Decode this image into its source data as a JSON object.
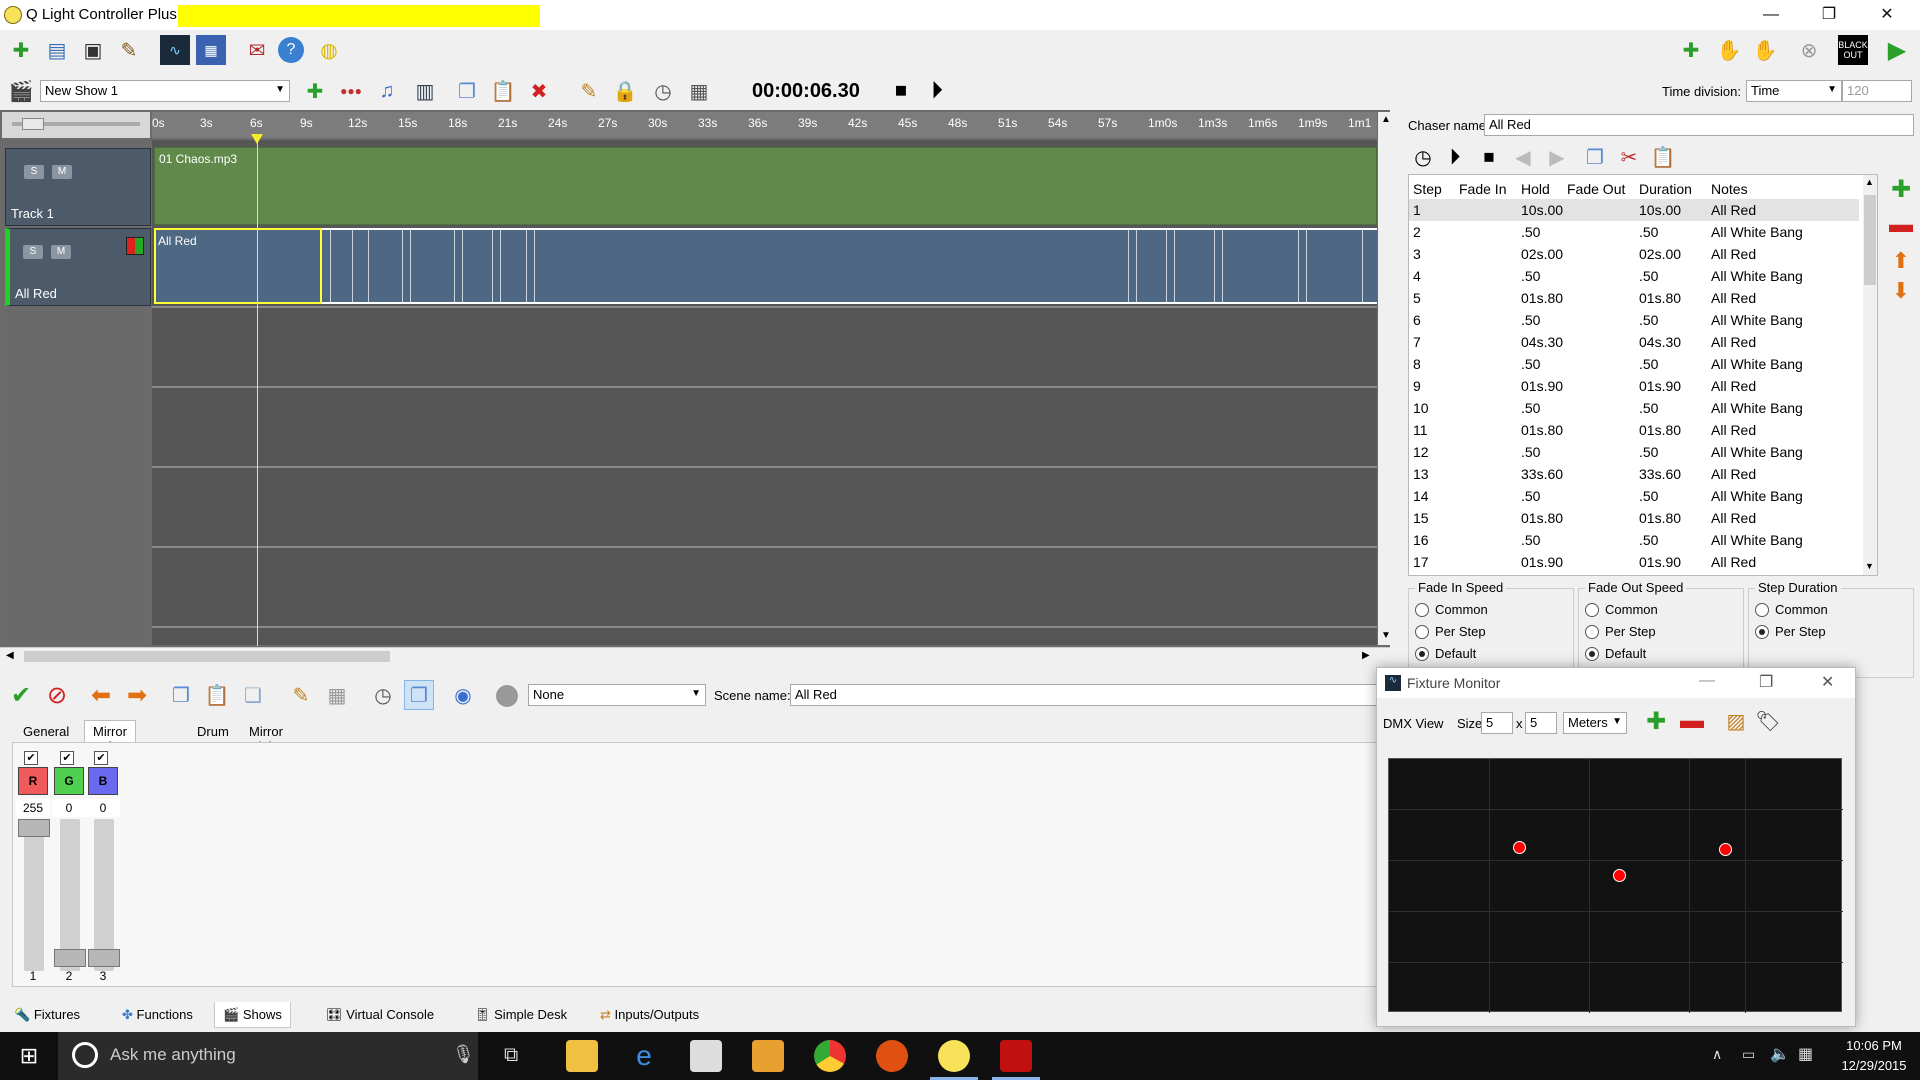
{
  "window": {
    "title": "Q Light Controller Plus",
    "controls": [
      "—",
      "❐",
      "✕"
    ]
  },
  "toolbar": {
    "items": [
      "new-workspace",
      "open-workspace",
      "save-workspace",
      "save-as",
      "monitor",
      "dmx-dump",
      "address-tool",
      "help",
      "about"
    ],
    "right_items": [
      "blackout-toggle-label",
      "run-mode"
    ],
    "blackout_label_line1": "BLACK",
    "blackout_label_line2": "OUT"
  },
  "show_toolbar": {
    "show_name": "New Show 1",
    "time": "00:00:06.30",
    "time_division_label": "Time division:",
    "time_division_value": "Time",
    "bpm_value": "120"
  },
  "timeline": {
    "ticks": [
      "0s",
      "3s",
      "6s",
      "9s",
      "12s",
      "15s",
      "18s",
      "21s",
      "24s",
      "27s",
      "30s",
      "33s",
      "36s",
      "39s",
      "42s",
      "45s",
      "48s",
      "51s",
      "54s",
      "57s",
      "1m0s",
      "1m3s",
      "1m6s",
      "1m9s",
      "1m1"
    ],
    "tracks": [
      {
        "name": "Track 1",
        "solo": "S",
        "mute": "M"
      },
      {
        "name": "All Red",
        "solo": "S",
        "mute": "M"
      }
    ],
    "audio_item_label": "01 Chaos.mp3",
    "chaser_item_label": "All Red"
  },
  "chaser_editor": {
    "name_label": "Chaser name",
    "name_value": "All Red",
    "columns": [
      "Step",
      "Fade In",
      "Hold",
      "Fade Out",
      "Duration",
      "Notes"
    ],
    "rows": [
      {
        "step": "1",
        "fade_in": "",
        "hold": "10s.00",
        "fade_out": "",
        "duration": "10s.00",
        "notes": "All Red"
      },
      {
        "step": "2",
        "fade_in": "",
        "hold": ".50",
        "fade_out": "",
        "duration": ".50",
        "notes": "All White Bang"
      },
      {
        "step": "3",
        "fade_in": "",
        "hold": "02s.00",
        "fade_out": "",
        "duration": "02s.00",
        "notes": "All Red"
      },
      {
        "step": "4",
        "fade_in": "",
        "hold": ".50",
        "fade_out": "",
        "duration": ".50",
        "notes": "All White Bang"
      },
      {
        "step": "5",
        "fade_in": "",
        "hold": "01s.80",
        "fade_out": "",
        "duration": "01s.80",
        "notes": "All Red"
      },
      {
        "step": "6",
        "fade_in": "",
        "hold": ".50",
        "fade_out": "",
        "duration": ".50",
        "notes": "All White Bang"
      },
      {
        "step": "7",
        "fade_in": "",
        "hold": "04s.30",
        "fade_out": "",
        "duration": "04s.30",
        "notes": "All Red"
      },
      {
        "step": "8",
        "fade_in": "",
        "hold": ".50",
        "fade_out": "",
        "duration": ".50",
        "notes": "All White Bang"
      },
      {
        "step": "9",
        "fade_in": "",
        "hold": "01s.90",
        "fade_out": "",
        "duration": "01s.90",
        "notes": "All Red"
      },
      {
        "step": "10",
        "fade_in": "",
        "hold": ".50",
        "fade_out": "",
        "duration": ".50",
        "notes": "All White Bang"
      },
      {
        "step": "11",
        "fade_in": "",
        "hold": "01s.80",
        "fade_out": "",
        "duration": "01s.80",
        "notes": "All Red"
      },
      {
        "step": "12",
        "fade_in": "",
        "hold": ".50",
        "fade_out": "",
        "duration": ".50",
        "notes": "All White Bang"
      },
      {
        "step": "13",
        "fade_in": "",
        "hold": "33s.60",
        "fade_out": "",
        "duration": "33s.60",
        "notes": "All Red"
      },
      {
        "step": "14",
        "fade_in": "",
        "hold": ".50",
        "fade_out": "",
        "duration": ".50",
        "notes": "All White Bang"
      },
      {
        "step": "15",
        "fade_in": "",
        "hold": "01s.80",
        "fade_out": "",
        "duration": "01s.80",
        "notes": "All Red"
      },
      {
        "step": "16",
        "fade_in": "",
        "hold": ".50",
        "fade_out": "",
        "duration": ".50",
        "notes": "All White Bang"
      },
      {
        "step": "17",
        "fade_in": "",
        "hold": "01s.90",
        "fade_out": "",
        "duration": "01s.90",
        "notes": "All Red"
      }
    ],
    "groups": [
      {
        "title": "Fade In Speed",
        "options": [
          "Common",
          "Per Step",
          "Default"
        ],
        "selected": "Default"
      },
      {
        "title": "Fade Out Speed",
        "options": [
          "Common",
          "Per Step",
          "Default"
        ],
        "selected": "Default"
      },
      {
        "title": "Step Duration",
        "options": [
          "Common",
          "Per Step"
        ],
        "selected": "Per Step"
      }
    ]
  },
  "scene_editor": {
    "fixture_combo": "None",
    "scene_name_label": "Scene name:",
    "scene_name_value": "All Red",
    "tabs": [
      "General",
      "Mirror Left",
      "Drum",
      "Mirror Right"
    ],
    "active_tab": "Mirror Left",
    "channels": [
      {
        "label": "R",
        "value": "255",
        "number": "1",
        "color": "#f05a5a",
        "level": 1.0
      },
      {
        "label": "G",
        "value": "0",
        "number": "2",
        "color": "#50d050",
        "level": 0.0
      },
      {
        "label": "B",
        "value": "0",
        "number": "3",
        "color": "#6a6af0",
        "level": 0.0
      }
    ]
  },
  "bottom_tabs": [
    "Fixtures",
    "Functions",
    "Shows",
    "Virtual Console",
    "Simple Desk",
    "Inputs/Outputs"
  ],
  "active_bottom_tab": "Shows",
  "fixture_monitor": {
    "title": "Fixture Monitor",
    "view_label": "DMX View",
    "size_label": "Size",
    "size_x": "5",
    "size_sep": "x",
    "size_y": "5",
    "unit": "Meters",
    "fixture_color": "#ff0000"
  },
  "taskbar": {
    "search_placeholder": "Ask me anything",
    "time": "10:06 PM",
    "date": "12/29/2015"
  }
}
